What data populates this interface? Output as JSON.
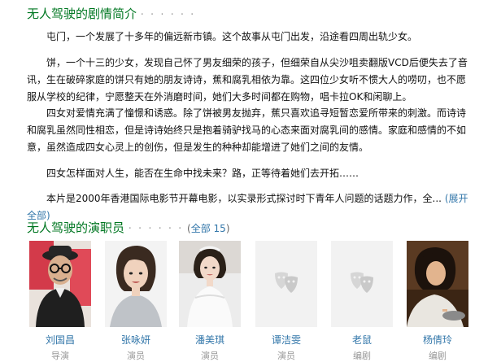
{
  "synopsis": {
    "title": "无人驾驶的剧情简介",
    "dots": "· · · · · ·",
    "paragraphs": [
      "屯门，一个发展了十多年的偏远新市镇。这个故事从屯门出发，沿途看四周出轨少女。",
      "饼，一个十三的少女，发现自己怀了男友细荣的孩子，但细荣自从尖沙咀卖翻版VCD后便失去了音讯，生在破碎家庭的饼只有她的朋友诗诗，蕉和腐乳相依为靠。这四位少女听不惯大人的唠叨，也不愿服从学校的纪律，宁愿整天在外消磨时间，她们大多时间都在购物，唱卡拉OK和闲聊上。",
      "四女对爱情充满了憧憬和诱惑。除了饼被男友抛弃，蕉只喜欢追寻短暂恋爱所带来的刺激。而诗诗和腐乳虽然同性相恋，但是诗诗始终只是抱着骑驴找马的心态来面对腐乳间的感情。家庭和感情的不如意，虽然造成四女心灵上的创伤，但是发生的种种却能增进了她们之间的友情。",
      "四女怎样面对人生，能否在生命中找未来？路，正等待着她们去开拓……",
      "本片是2000年香港国际电影节开幕电影，以实录形式探讨时下青年人问题的话题力作，全..."
    ],
    "expand_label": "(展开全部)"
  },
  "cast": {
    "title": "无人驾驶的演职员",
    "dots": "· · · · · ·",
    "all_open": "(",
    "all_label": "全部 15",
    "all_close": ")",
    "members": [
      {
        "name": "刘国昌",
        "role": "导演",
        "photo": "man-glasses-hat"
      },
      {
        "name": "张咏妍",
        "role": "演员",
        "photo": "woman-short-hair"
      },
      {
        "name": "潘美琪",
        "role": "演员",
        "photo": "woman-bridal"
      },
      {
        "name": "谭洁雯",
        "role": "演员",
        "photo": "placeholder"
      },
      {
        "name": "老鼠",
        "role": "编剧",
        "photo": "placeholder"
      },
      {
        "name": "杨倩玲",
        "role": "编剧",
        "photo": "woman-cooking"
      }
    ]
  },
  "colors": {
    "green": "#007722",
    "link": "#3377aa",
    "muted": "#999999"
  }
}
